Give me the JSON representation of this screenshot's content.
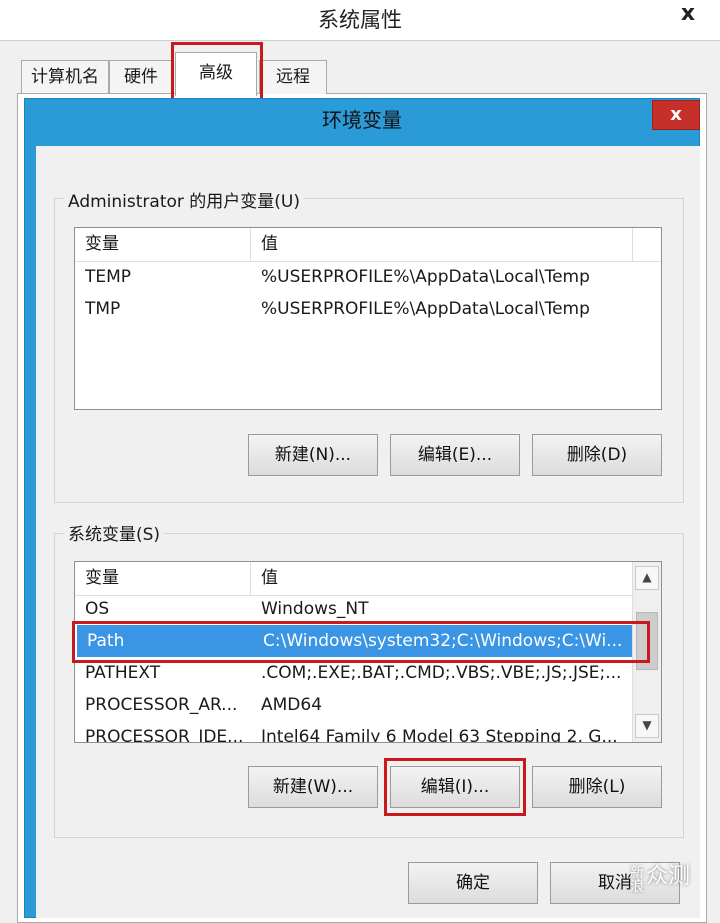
{
  "outer_dialog": {
    "title": "系统属性",
    "close": "x",
    "tabs": [
      "计算机名",
      "硬件",
      "高级",
      "远程"
    ],
    "active_tab": "高级"
  },
  "env_dialog": {
    "title": "环境变量",
    "close": "x",
    "user_vars": {
      "label": "Administrator 的用户变量(U)",
      "columns": [
        "变量",
        "值"
      ],
      "rows": [
        {
          "name": "TEMP",
          "value": "%USERPROFILE%\\AppData\\Local\\Temp"
        },
        {
          "name": "TMP",
          "value": "%USERPROFILE%\\AppData\\Local\\Temp"
        }
      ],
      "buttons": {
        "new": "新建(N)...",
        "edit": "编辑(E)...",
        "delete": "删除(D)"
      }
    },
    "system_vars": {
      "label": "系统变量(S)",
      "columns": [
        "变量",
        "值"
      ],
      "rows": [
        {
          "name": "OS",
          "value": "Windows_NT"
        },
        {
          "name": "Path",
          "value": "C:\\Windows\\system32;C:\\Windows;C:\\Wi..."
        },
        {
          "name": "PATHEXT",
          "value": ".COM;.EXE;.BAT;.CMD;.VBS;.VBE;.JS;.JSE;..."
        },
        {
          "name": "PROCESSOR_AR...",
          "value": "AMD64"
        },
        {
          "name": "PROCESSOR_IDE...",
          "value": "Intel64 Family 6 Model 63 Stepping 2, G..."
        }
      ],
      "selected_row": "Path",
      "buttons": {
        "new": "新建(W)...",
        "edit": "编辑(I)...",
        "delete": "删除(L)"
      }
    },
    "footer": {
      "ok": "确定",
      "cancel": "取消"
    }
  },
  "watermark": {
    "small": "新浪",
    "text": "众测"
  },
  "colors": {
    "highlight": "#c8191f",
    "selection": "#3a95e5",
    "title_bar": "#2b9bd8",
    "close_button": "#c7302a"
  },
  "icons": {
    "scroll_up": "chevron-up-icon",
    "scroll_down": "chevron-down-icon"
  }
}
